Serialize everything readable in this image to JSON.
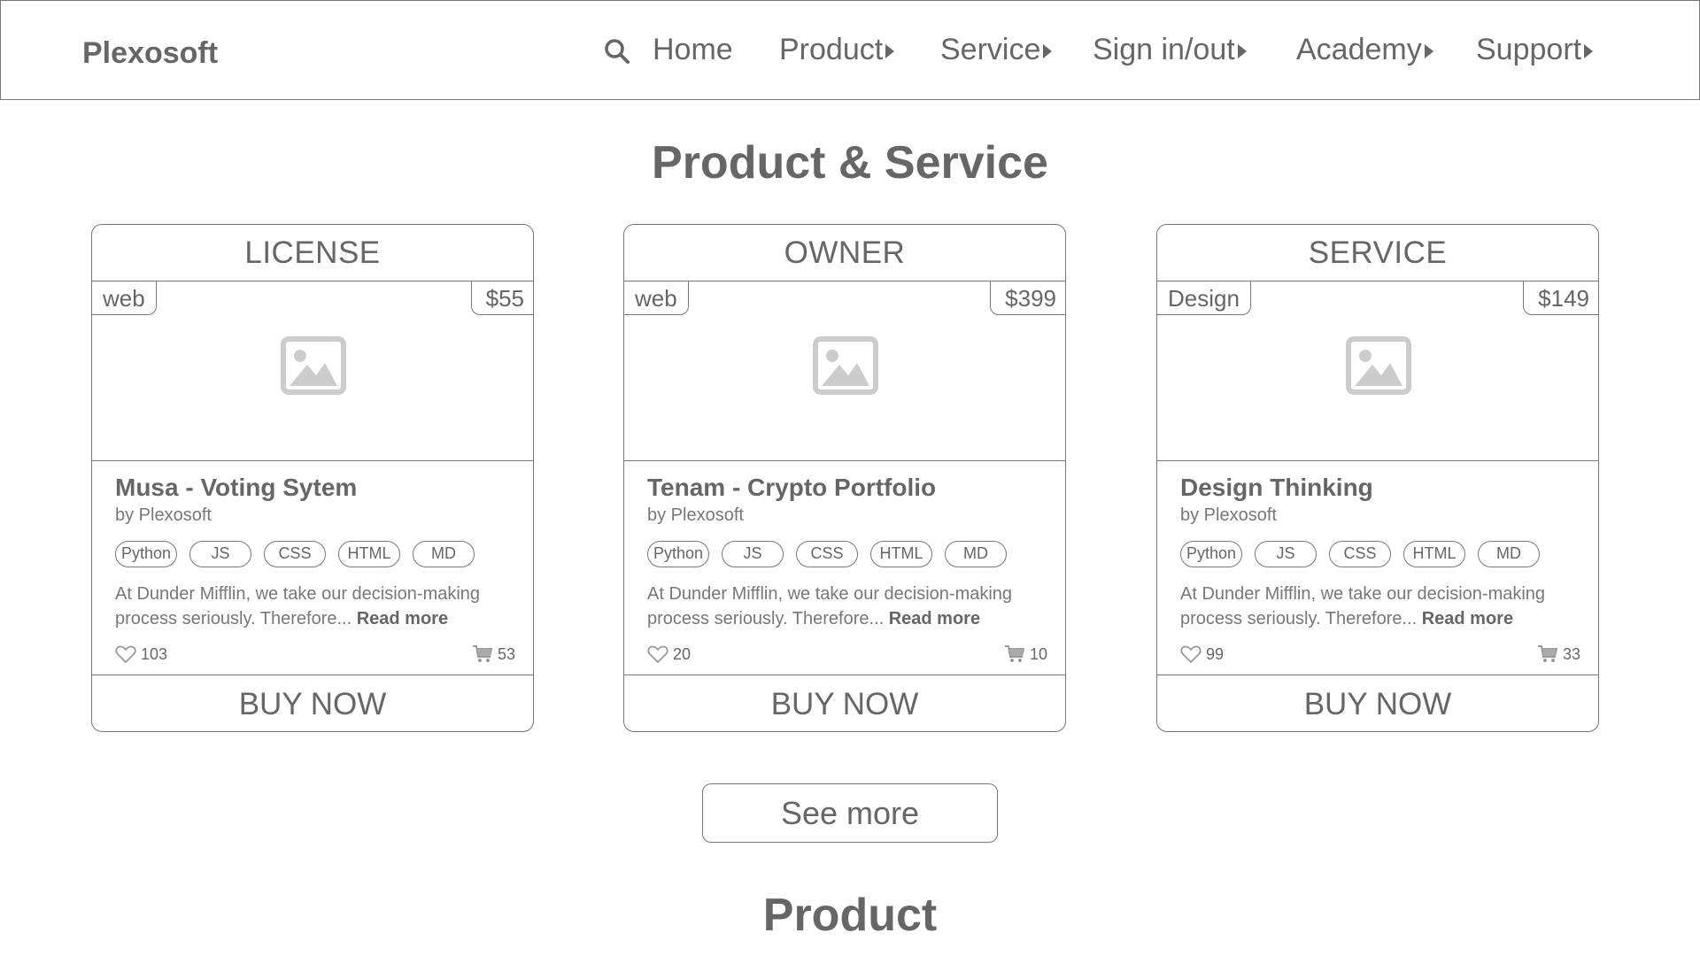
{
  "header": {
    "logo": "Plexosoft",
    "nav": {
      "home": "Home",
      "product": "Product",
      "service": "Service",
      "signin": "Sign in/out",
      "academy": "Academy",
      "support": "Support"
    }
  },
  "main": {
    "section_title": "Product & Service",
    "cards": [
      {
        "category": "LICENSE",
        "tag": "web",
        "price": "$55",
        "title": "Musa - Voting Sytem",
        "author": "by Plexosoft",
        "techs": [
          "Python",
          "JS",
          "CSS",
          "HTML",
          "MD"
        ],
        "description": "At Dunder Mifflin, we take our decision-making process seriously. Therefore...",
        "read_more": "Read more",
        "likes": "103",
        "cart": "53",
        "buy_label": "BUY NOW"
      },
      {
        "category": "OWNER",
        "tag": "web",
        "price": "$399",
        "title": "Tenam - Crypto Portfolio",
        "author": "by Plexosoft",
        "techs": [
          "Python",
          "JS",
          "CSS",
          "HTML",
          "MD"
        ],
        "description": "At Dunder Mifflin, we take our decision-making process seriously. Therefore...",
        "read_more": "Read more",
        "likes": "20",
        "cart": "10",
        "buy_label": "BUY NOW"
      },
      {
        "category": "SERVICE",
        "tag": "Design",
        "price": "$149",
        "title": "Design Thinking",
        "author": "by Plexosoft",
        "techs": [
          "Python",
          "JS",
          "CSS",
          "HTML",
          "MD"
        ],
        "description": "At Dunder Mifflin, we take our decision-making process seriously. Therefore...",
        "read_more": "Read more",
        "likes": "99",
        "cart": "33",
        "buy_label": "BUY NOW"
      }
    ],
    "see_more": "See more",
    "next_section_title": "Product"
  },
  "icons": {
    "search": "search-icon",
    "image": "image-placeholder-icon",
    "heart": "heart-icon",
    "cart": "cart-icon",
    "caret": "caret-right-icon"
  },
  "colors": {
    "ink": "#666666",
    "border": "#777777",
    "placeholder": "#cccccc"
  }
}
